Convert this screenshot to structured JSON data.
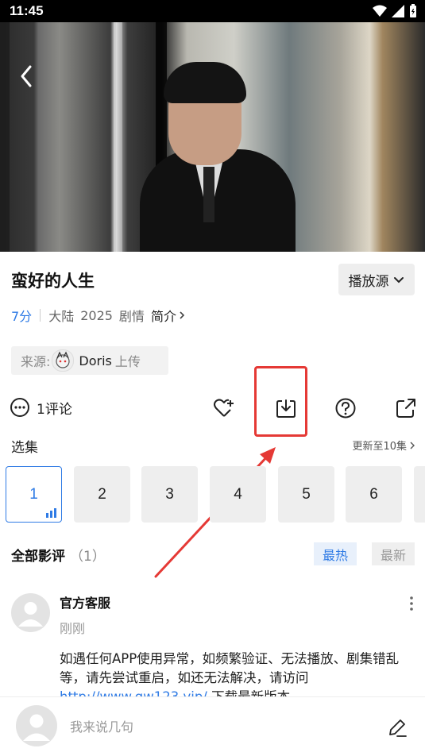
{
  "status_bar": {
    "time": "11:45"
  },
  "show": {
    "title": "蛮好的人生",
    "source_button": "播放源",
    "score": "7分",
    "region": "大陆",
    "year": "2025",
    "genre": "剧情",
    "intro": "简介"
  },
  "uploader": {
    "label": "来源:",
    "name": "Doris",
    "suffix": "上传"
  },
  "actions": {
    "comments": "1评论"
  },
  "episodes": {
    "title": "选集",
    "update": "更新至10集",
    "items": [
      "1",
      "2",
      "3",
      "4",
      "5",
      "6"
    ]
  },
  "reviews": {
    "title": "全部影评",
    "count": "（1）",
    "sort_hot": "最热",
    "sort_new": "最新",
    "items": [
      {
        "user": "官方客服",
        "time": "刚刚",
        "text": "如遇任何APP使用异常，如频繁验证、无法播放、剧集错乱等，请先尝试重启，如还无法解决，请访问",
        "link": "http://www.gw123.vip/",
        "text_after": "下载最新版本。"
      }
    ]
  },
  "bottom": {
    "input_placeholder": "我来说几句"
  },
  "colors": {
    "accent": "#2f7be5",
    "highlight": "#e53935"
  }
}
